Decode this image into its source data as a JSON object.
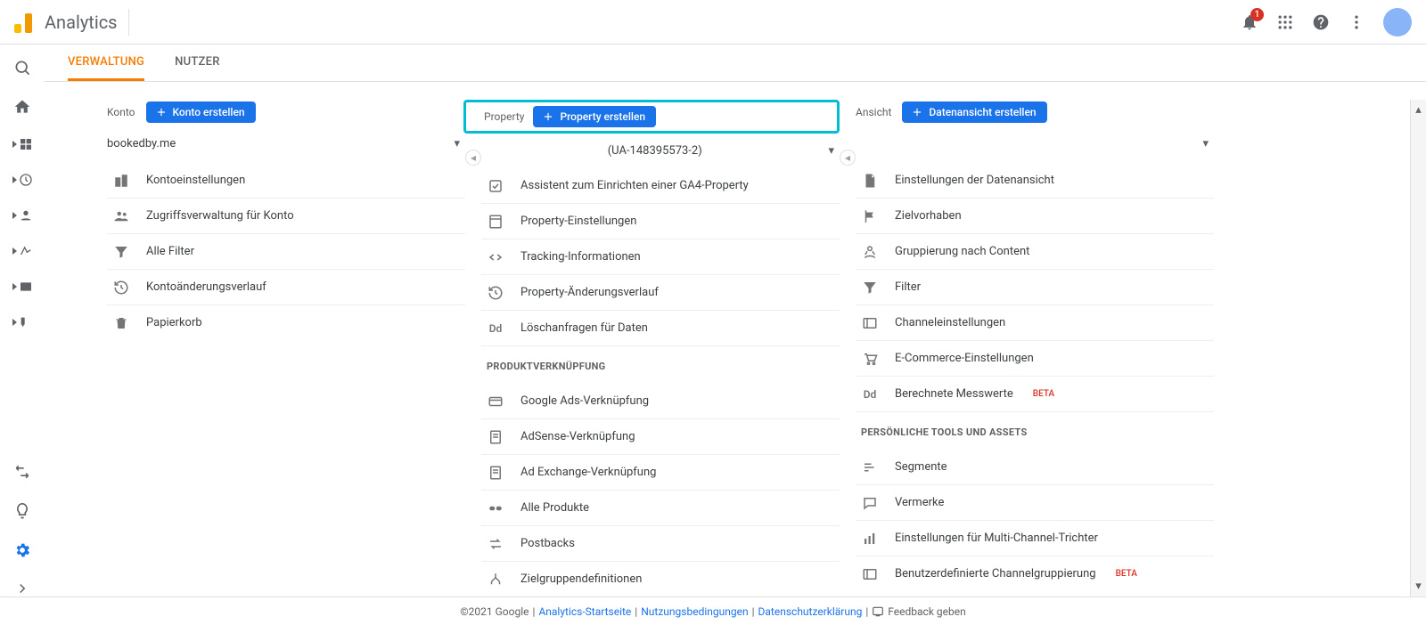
{
  "app": {
    "name": "Analytics",
    "notif_count": "1"
  },
  "tabs": {
    "admin": "VERWALTUNG",
    "users": "NUTZER"
  },
  "columns": {
    "account": {
      "label": "Konto",
      "create_btn": "Konto erstellen",
      "selected": "bookedby.me",
      "items": [
        {
          "icon": "building",
          "text": "Kontoeinstellungen"
        },
        {
          "icon": "people",
          "text": "Zugriffsverwaltung für Konto"
        },
        {
          "icon": "filter",
          "text": "Alle Filter"
        },
        {
          "icon": "history",
          "text": "Kontoänderungsverlauf"
        },
        {
          "icon": "trash",
          "text": "Papierkorb"
        }
      ]
    },
    "property": {
      "label": "Property",
      "create_btn": "Property erstellen",
      "selected": "(UA-148395573-2)",
      "items": [
        {
          "icon": "checkbox",
          "text": "Assistent zum Einrichten einer GA4-Property"
        },
        {
          "icon": "sheet",
          "text": "Property-Einstellungen"
        },
        {
          "icon": "code",
          "text": "Tracking-Informationen"
        },
        {
          "icon": "history",
          "text": "Property-Änderungsverlauf"
        },
        {
          "icon": "dd",
          "text": "Löschanfragen für Daten"
        }
      ],
      "section1": "PRODUKTVERKNÜPFUNG",
      "section1_items": [
        {
          "icon": "card",
          "text": "Google Ads-Verknüpfung"
        },
        {
          "icon": "doc",
          "text": "AdSense-Verknüpfung"
        },
        {
          "icon": "doc",
          "text": "Ad Exchange-Verknüpfung"
        },
        {
          "icon": "link",
          "text": "Alle Produkte"
        },
        {
          "icon": "swap",
          "text": "Postbacks"
        },
        {
          "icon": "branch",
          "text": "Zielgruppendefinitionen"
        }
      ]
    },
    "view": {
      "label": "Ansicht",
      "create_btn": "Datenansicht erstellen",
      "selected": "",
      "items": [
        {
          "icon": "doc2",
          "text": "Einstellungen der Datenansicht"
        },
        {
          "icon": "flag",
          "text": "Zielvorhaben"
        },
        {
          "icon": "person",
          "text": "Gruppierung nach Content"
        },
        {
          "icon": "filter",
          "text": "Filter"
        },
        {
          "icon": "channel",
          "text": "Channeleinstellungen"
        },
        {
          "icon": "cart",
          "text": "E-Commerce-Einstellungen"
        },
        {
          "icon": "dd",
          "text": "Berechnete Messwerte",
          "beta": "BETA"
        }
      ],
      "section1": "PERSÖNLICHE TOOLS UND ASSETS",
      "section1_items": [
        {
          "icon": "segments",
          "text": "Segmente"
        },
        {
          "icon": "comment",
          "text": "Vermerke"
        },
        {
          "icon": "chart",
          "text": "Einstellungen für Multi-Channel-Trichter"
        },
        {
          "icon": "channel",
          "text": "Benutzerdefinierte Channelgruppierung",
          "beta": "BETA"
        }
      ]
    }
  },
  "footer": {
    "copyright": "©2021 Google",
    "link1": "Analytics-Startseite",
    "link2": "Nutzungsbedingungen",
    "link3": "Datenschutzerklärung",
    "feedback": "Feedback geben"
  }
}
